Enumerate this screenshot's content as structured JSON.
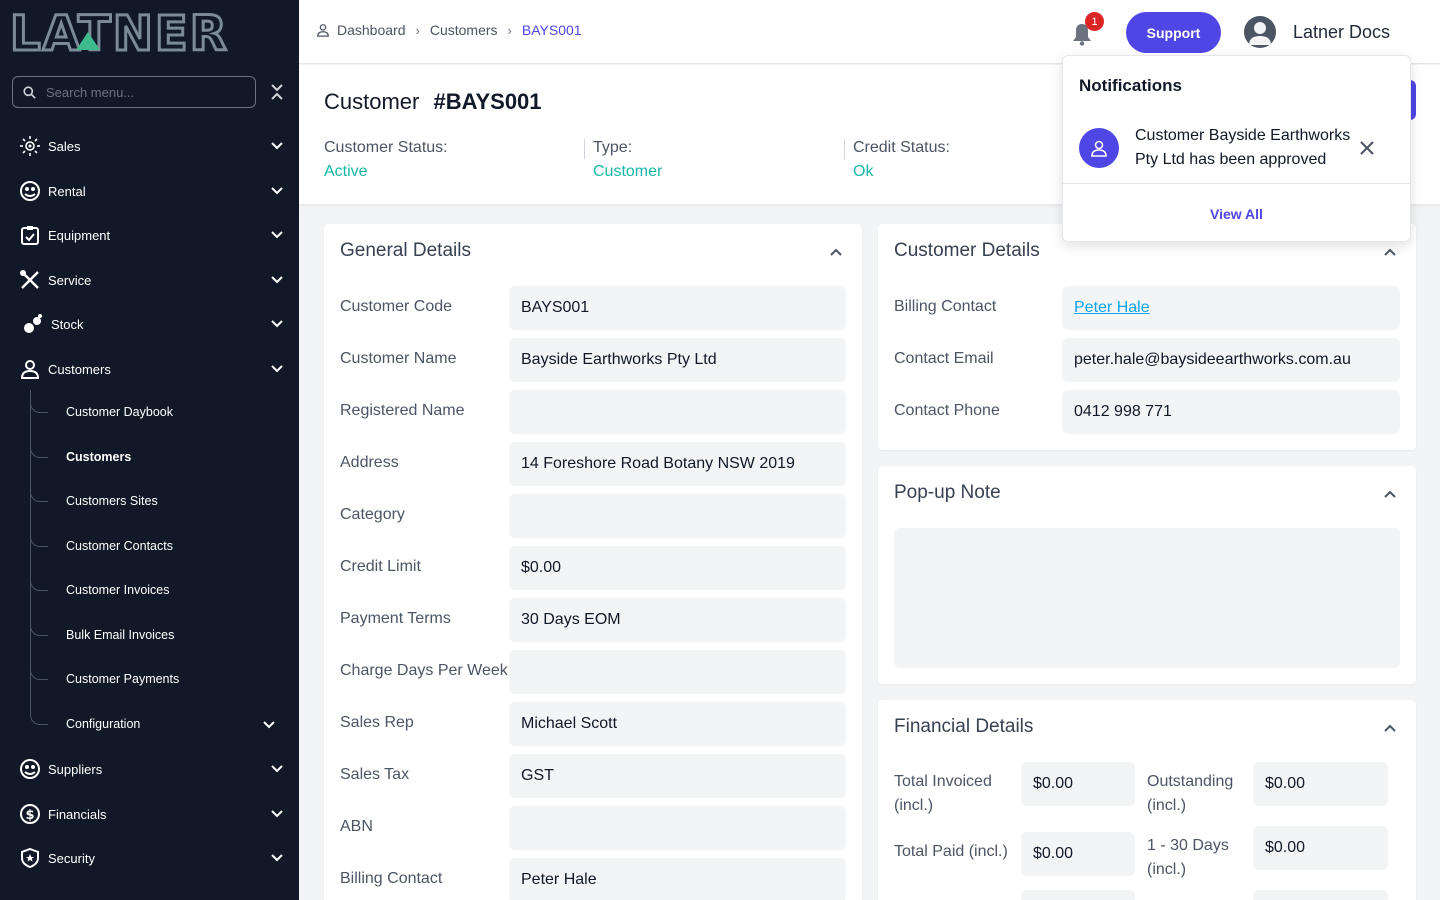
{
  "app": {
    "logo_text": "LATNER"
  },
  "search": {
    "placeholder": "Search menu..."
  },
  "sidebar": {
    "items": [
      {
        "label": "Sales",
        "icon": "sales-icon"
      },
      {
        "label": "Rental",
        "icon": "rental-icon"
      },
      {
        "label": "Equipment",
        "icon": "equipment-icon"
      },
      {
        "label": "Service",
        "icon": "service-icon"
      },
      {
        "label": "Stock",
        "icon": "stock-icon"
      },
      {
        "label": "Customers",
        "icon": "user-icon"
      },
      {
        "label": "Suppliers",
        "icon": "suppliers-icon"
      },
      {
        "label": "Financials",
        "icon": "financials-icon"
      },
      {
        "label": "Security",
        "icon": "shield-icon"
      }
    ],
    "customers_sub": [
      {
        "label": "Customer Daybook"
      },
      {
        "label": "Customers"
      },
      {
        "label": "Customers Sites"
      },
      {
        "label": "Customer Contacts"
      },
      {
        "label": "Customer Invoices"
      },
      {
        "label": "Bulk Email Invoices"
      },
      {
        "label": "Customer Payments"
      },
      {
        "label": "Configuration"
      }
    ]
  },
  "breadcrumb": {
    "home": "Dashboard",
    "section": "Customers",
    "current": "BAYS001"
  },
  "topbar": {
    "notification_count": "1",
    "support_label": "Support",
    "user_name": "Latner Docs"
  },
  "customer": {
    "title_prefix": "Customer",
    "title_id": "#BAYS001",
    "status_label": "Customer Status:",
    "status_value": "Active",
    "type_label": "Type:",
    "type_value": "Customer",
    "credit_label": "Credit Status:",
    "credit_value": "Ok"
  },
  "general": {
    "title": "General Details",
    "fields": [
      {
        "label": "Customer Code",
        "value": "BAYS001"
      },
      {
        "label": "Customer Name",
        "value": "Bayside Earthworks Pty Ltd"
      },
      {
        "label": "Registered Name",
        "value": ""
      },
      {
        "label": "Address",
        "value": "14 Foreshore Road Botany NSW 2019"
      },
      {
        "label": "Category",
        "value": ""
      },
      {
        "label": "Credit Limit",
        "value": "$0.00"
      },
      {
        "label": "Payment Terms",
        "value": "30 Days EOM"
      },
      {
        "label": "Charge Days Per Week",
        "value": ""
      },
      {
        "label": "Sales Rep",
        "value": "Michael Scott"
      },
      {
        "label": "Sales Tax",
        "value": "GST"
      },
      {
        "label": "ABN",
        "value": ""
      },
      {
        "label": "Billing Contact",
        "value": "Peter Hale"
      }
    ]
  },
  "customer_details": {
    "title": "Customer Details",
    "fields": [
      {
        "label": "Billing Contact",
        "value": "Peter Hale"
      },
      {
        "label": "Contact Email",
        "value": "peter.hale@baysideearthworks.com.au"
      },
      {
        "label": "Contact Phone",
        "value": "0412 998 771"
      }
    ]
  },
  "popup_note": {
    "title": "Pop-up Note",
    "value": ""
  },
  "financial": {
    "title": "Financial Details",
    "total_invoiced_label_1": "Total Invoiced",
    "total_invoiced_label_2": "(incl.)",
    "total_invoiced": "$0.00",
    "outstanding_label_1": "Outstanding",
    "outstanding_label_2": "(incl.)",
    "outstanding": "$0.00",
    "total_paid_label": "Total Paid (incl.)",
    "total_paid": "$0.00",
    "days_1_30_label_1": "1 - 30 Days",
    "days_1_30_label_2": "(incl.)",
    "days_1_30": "$0.00"
  },
  "notifications": {
    "title": "Notifications",
    "message": "Customer Bayside Earthworks Pty Ltd has been approved",
    "view_all": "View All"
  },
  "colors": {
    "sidebar_bg": "#111827",
    "accent": "#4f46e5",
    "status_ok": "#14b8a6",
    "logo": "#7b8a96",
    "logo_accent": "#3fb98e"
  }
}
